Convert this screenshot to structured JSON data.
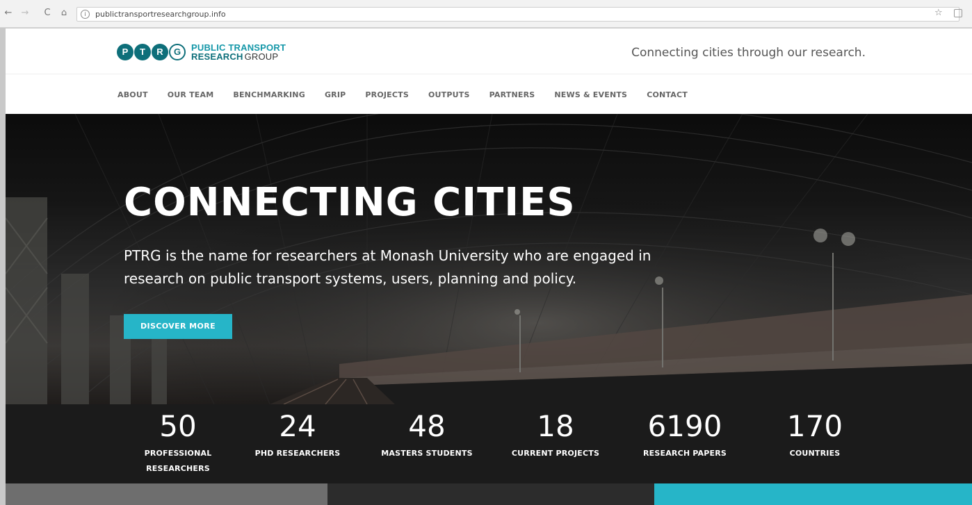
{
  "browser": {
    "url": "publictransportresearchgroup.info",
    "back_icon": "←",
    "forward_icon": "→",
    "reload_icon": "C",
    "home_icon": "⌂",
    "info_icon": "i",
    "star_icon": "☆"
  },
  "header": {
    "logo_letters": [
      "P",
      "T",
      "R",
      "G"
    ],
    "logo_line1": "PUBLIC TRANSPORT",
    "logo_line2_bold": "RESEARCH",
    "logo_line2_light": "GROUP",
    "tagline": "Connecting cities through our research."
  },
  "nav": {
    "items": [
      "ABOUT",
      "OUR TEAM",
      "BENCHMARKING",
      "GRIP",
      "PROJECTS",
      "OUTPUTS",
      "PARTNERS",
      "NEWS & EVENTS",
      "CONTACT"
    ]
  },
  "hero": {
    "title": "CONNECTING CITIES",
    "text": "PTRG is the name for researchers at Monash University who are engaged in research on public transport systems, users, planning and policy.",
    "cta_label": "DISCOVER MORE"
  },
  "stats": [
    {
      "number": "50",
      "label_line1": "PROFESSIONAL",
      "label_line2": "RESEARCHERS"
    },
    {
      "number": "24",
      "label_line1": "PHD RESEARCHERS",
      "label_line2": ""
    },
    {
      "number": "48",
      "label_line1": "MASTERS STUDENTS",
      "label_line2": ""
    },
    {
      "number": "18",
      "label_line1": "CURRENT PROJECTS",
      "label_line2": ""
    },
    {
      "number": "6190",
      "label_line1": "RESEARCH PAPERS",
      "label_line2": ""
    },
    {
      "number": "170",
      "label_line1": "COUNTRIES",
      "label_line2": ""
    }
  ],
  "colors": {
    "brand_teal": "#1497a8",
    "brand_dark_teal": "#0e6f7a",
    "cta": "#26b5c8",
    "stats_bg": "#1b1b1b"
  }
}
